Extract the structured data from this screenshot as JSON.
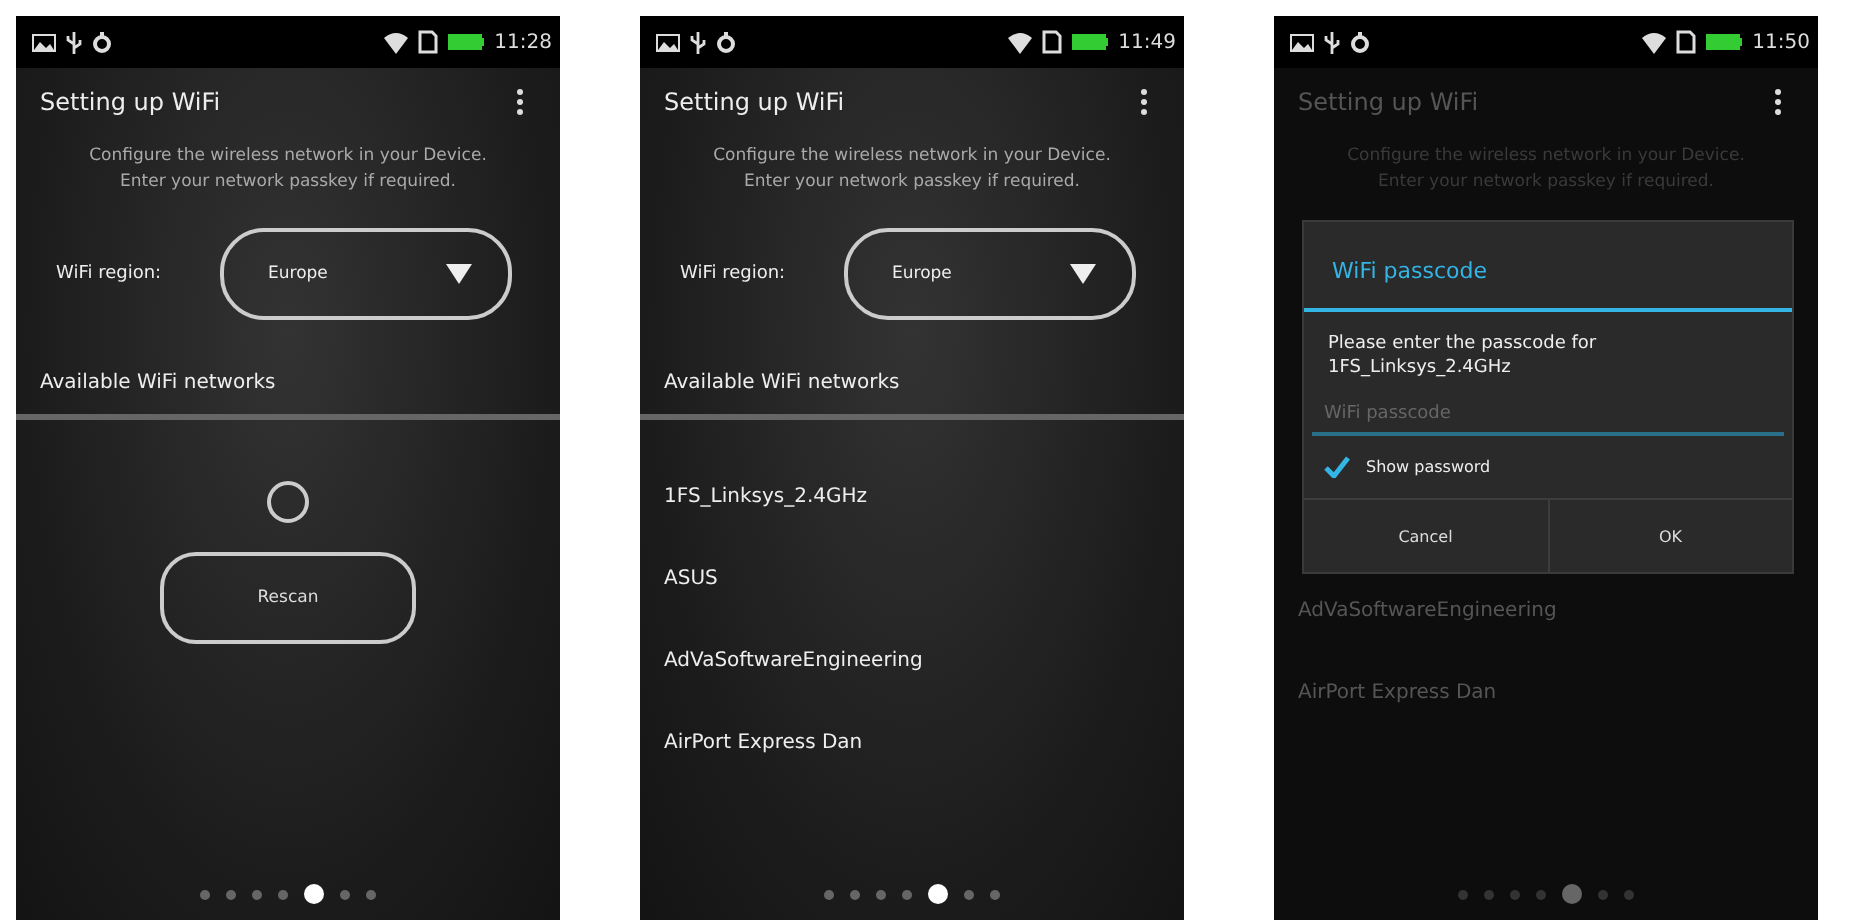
{
  "screens": [
    {
      "kind": "scanning",
      "dimmed": false,
      "status_bar": {
        "time": "11:28"
      },
      "title": "Setting up WiFi",
      "description": "Configure the wireless network in your Device. Enter your network passkey if required.",
      "region": {
        "label": "WiFi region:",
        "value": "Europe"
      },
      "networks_heading": "Available WiFi networks",
      "rescan_button": "Rescan",
      "page_dots": [
        {
          "selected": false
        },
        {
          "selected": false
        },
        {
          "selected": false
        },
        {
          "selected": false
        },
        {
          "selected": true
        },
        {
          "selected": false
        },
        {
          "selected": false
        }
      ]
    },
    {
      "kind": "list",
      "dimmed": false,
      "status_bar": {
        "time": "11:49"
      },
      "title": "Setting up WiFi",
      "description": "Configure the wireless network in your Device. Enter your network passkey if required.",
      "region": {
        "label": "WiFi region:",
        "value": "Europe"
      },
      "networks_heading": "Available WiFi networks",
      "networks": [
        "1FS_Linksys_2.4GHz",
        "ASUS",
        "AdVaSoftwareEngineering",
        "AirPort Express Dan"
      ],
      "page_dots": [
        {
          "selected": false
        },
        {
          "selected": false
        },
        {
          "selected": false
        },
        {
          "selected": false
        },
        {
          "selected": true
        },
        {
          "selected": false
        },
        {
          "selected": false
        }
      ]
    },
    {
      "kind": "dialog",
      "dimmed": true,
      "status_bar": {
        "time": "11:50"
      },
      "title": "Setting up WiFi",
      "description": "Configure the wireless network in your Device. Enter your network passkey if required.",
      "dialog": {
        "title": "WiFi passcode",
        "message": "Please enter the passcode for 1FS_Linksys_2.4GHz",
        "input": {
          "placeholder": "WiFi passcode"
        },
        "show_password": {
          "label": "Show password",
          "checked": true
        },
        "buttons": [
          "Cancel",
          "OK"
        ]
      },
      "networks": [
        "AdVaSoftwareEngineering",
        "AirPort Express Dan"
      ],
      "page_dots": [
        {
          "selected": false
        },
        {
          "selected": false
        },
        {
          "selected": false
        },
        {
          "selected": false
        },
        {
          "selected": true
        },
        {
          "selected": false
        },
        {
          "selected": false
        }
      ]
    }
  ]
}
